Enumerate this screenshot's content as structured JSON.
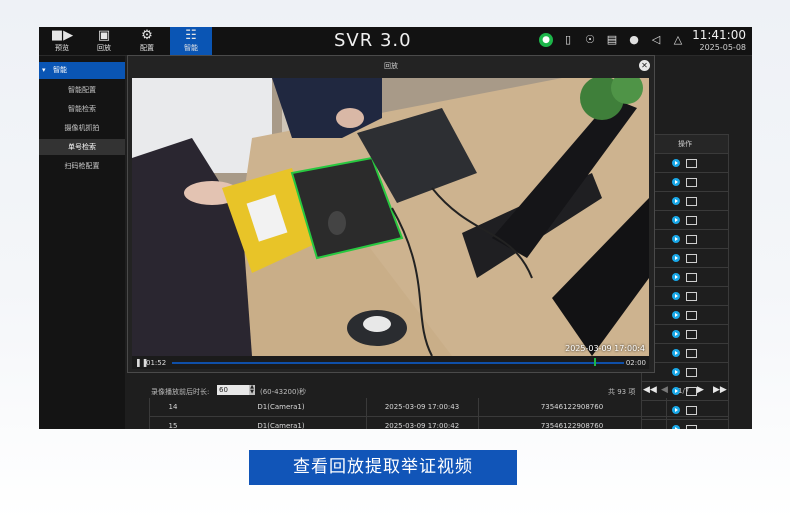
{
  "nav": {
    "preview": "预览",
    "playback": "回放",
    "config": "配置",
    "smart": "智能"
  },
  "app_title": "SVR 3.0",
  "status_icons": [
    "person-online-icon",
    "phone-icon",
    "globe-icon",
    "keyboard-icon",
    "mic-icon",
    "speaker-icon",
    "alarm-icon"
  ],
  "clock": {
    "time": "11:41:00",
    "date": "2025-05-08"
  },
  "sidebar": {
    "header": "智能",
    "items": [
      {
        "label": "智能配置",
        "selected": false
      },
      {
        "label": "智能检索",
        "selected": false
      },
      {
        "label": "摄像机抓拍",
        "selected": false
      },
      {
        "label": "单号检索",
        "selected": true
      },
      {
        "label": "扫码枪配置",
        "selected": false
      }
    ]
  },
  "table": {
    "op_header": "操作",
    "rows": [
      {
        "index": "14",
        "channel": "D1(Camera1)",
        "time": "2025-03-09 17:00:43",
        "code": "73546122908760"
      },
      {
        "index": "15",
        "channel": "D1(Camera1)",
        "time": "2025-03-09 17:00:42",
        "code": "73546122908760"
      }
    ]
  },
  "footer": {
    "label": "录像播放前后时长:",
    "value": "60",
    "range": "(60-43200)秒",
    "total": "共 93 项",
    "page": "1/7"
  },
  "modal": {
    "title": "回放",
    "video_timestamp": "2025-03-09 17:00:4",
    "time_current": "01:52",
    "time_total": "02:00"
  },
  "caption": "查看回放提取举证视频",
  "colors": {
    "accent": "#0a55b4",
    "online": "#1db64a",
    "play": "#19a8e8"
  }
}
